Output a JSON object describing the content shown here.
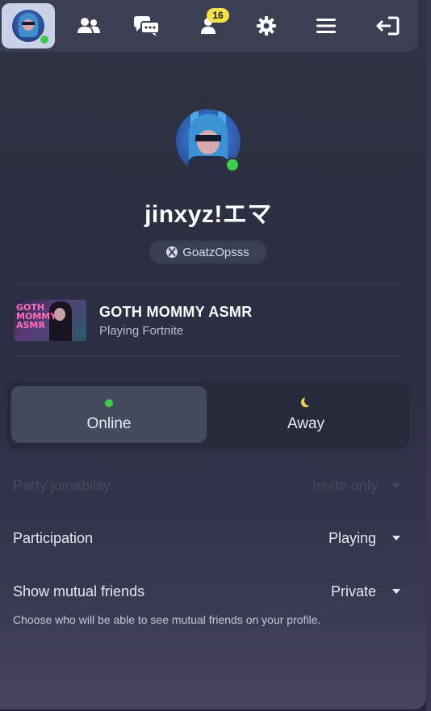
{
  "nav": {
    "notification_count": "16",
    "items": [
      "profile",
      "friends",
      "chats",
      "friend-requests",
      "settings",
      "menu",
      "logout"
    ]
  },
  "profile": {
    "display_name": "jinxyz!エマ",
    "platform_username": "GoatzOpsss",
    "status": "online"
  },
  "activity": {
    "title": "GOTH MOMMY ASMR",
    "subtitle": "Playing Fortnite",
    "thumbnail_text": "GOTH MOMMY ASMR"
  },
  "status_options": [
    {
      "label": "Online",
      "selected": true
    },
    {
      "label": "Away",
      "selected": false
    }
  ],
  "settings": [
    {
      "label": "Party joinability",
      "value": "Invite only",
      "disabled": true
    },
    {
      "label": "Participation",
      "value": "Playing",
      "disabled": false
    },
    {
      "label": "Show mutual friends",
      "value": "Private",
      "disabled": false
    }
  ],
  "help_text": "Choose who will be able to see mutual friends on your profile.",
  "colors": {
    "online": "#3ccc4a",
    "badge": "#f4e04a",
    "away": "#f4d34a"
  }
}
